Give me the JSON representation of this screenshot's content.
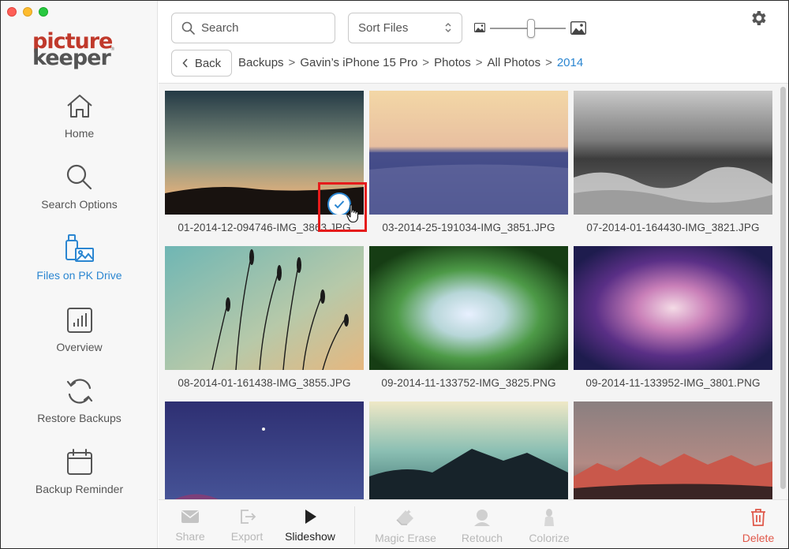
{
  "app": {
    "logo_line1": "picture",
    "logo_line2": "keeper",
    "logo_tm": "®"
  },
  "sidebar": {
    "items": [
      {
        "label": "Home",
        "icon": "home-icon",
        "active": false
      },
      {
        "label": "Search Options",
        "icon": "search-icon",
        "active": false
      },
      {
        "label": "Files on PK Drive",
        "icon": "drive-files-icon",
        "active": true
      },
      {
        "label": "Overview",
        "icon": "chart-icon",
        "active": false
      },
      {
        "label": "Restore Backups",
        "icon": "restore-icon",
        "active": false
      },
      {
        "label": "Backup Reminder",
        "icon": "calendar-icon",
        "active": false
      }
    ]
  },
  "header": {
    "search_placeholder": "Search",
    "sort_label": "Sort Files",
    "zoom_level": 0.54,
    "back_label": "Back",
    "breadcrumb": [
      "Backups",
      "Gavin’s iPhone 15 Pro",
      "Photos",
      "All Photos",
      "2014"
    ]
  },
  "grid": {
    "files": [
      {
        "name": "01-2014-12-094746-IMG_3863.JPG",
        "selected": true
      },
      {
        "name": "03-2014-25-191034-IMG_3851.JPG",
        "selected": false
      },
      {
        "name": "07-2014-01-164430-IMG_3821.JPG",
        "selected": false
      },
      {
        "name": "08-2014-01-161438-IMG_3855.JPG",
        "selected": false
      },
      {
        "name": "09-2014-11-133752-IMG_3825.PNG",
        "selected": false
      },
      {
        "name": "09-2014-11-133952-IMG_3801.PNG",
        "selected": false
      },
      {
        "name": "",
        "selected": false
      },
      {
        "name": "",
        "selected": false
      },
      {
        "name": "",
        "selected": false
      }
    ]
  },
  "toolbar": {
    "share": "Share",
    "export": "Export",
    "slideshow": "Slideshow",
    "magic_erase": "Magic Erase",
    "retouch": "Retouch",
    "colorize": "Colorize",
    "delete": "Delete"
  },
  "colors": {
    "accent": "#2b86d1",
    "logo_red": "#c0392b",
    "delete_red": "#e0584a",
    "highlight": "#e51b1b"
  }
}
